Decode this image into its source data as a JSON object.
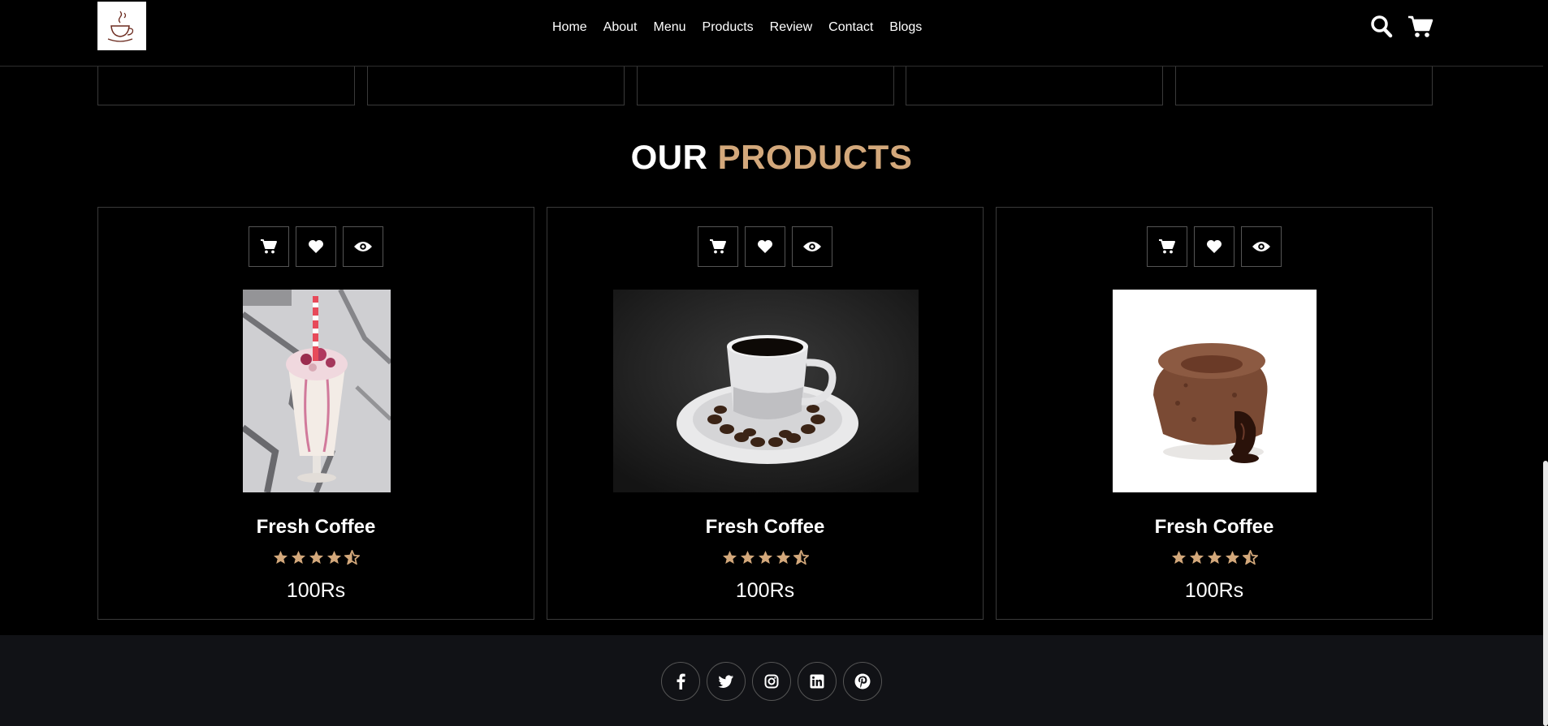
{
  "brand": {
    "logo_icon": "coffee-cup-logo"
  },
  "nav": {
    "items": [
      {
        "label": "Home"
      },
      {
        "label": "About"
      },
      {
        "label": "Menu"
      },
      {
        "label": "Products"
      },
      {
        "label": "Review"
      },
      {
        "label": "Contact"
      },
      {
        "label": "Blogs"
      }
    ]
  },
  "header_icons": [
    "search-icon",
    "cart-icon"
  ],
  "section": {
    "title_main": "OUR",
    "title_accent": "PRODUCTS"
  },
  "products": [
    {
      "name": "Fresh Coffee",
      "price": "100Rs",
      "rating": 4.5,
      "image": "milkshake-photo"
    },
    {
      "name": "Fresh Coffee",
      "price": "100Rs",
      "rating": 4.5,
      "image": "black-coffee-cup-photo"
    },
    {
      "name": "Fresh Coffee",
      "price": "100Rs",
      "rating": 4.5,
      "image": "chocolate-lava-cake-photo"
    }
  ],
  "product_actions": [
    "cart-icon",
    "heart-icon",
    "eye-icon"
  ],
  "social": [
    "facebook-icon",
    "twitter-icon",
    "instagram-icon",
    "linkedin-icon",
    "pinterest-icon"
  ],
  "colors": {
    "accent": "#d3a87b",
    "background": "#000000",
    "footer_bg": "#111216",
    "border": "#3a3a3a"
  }
}
